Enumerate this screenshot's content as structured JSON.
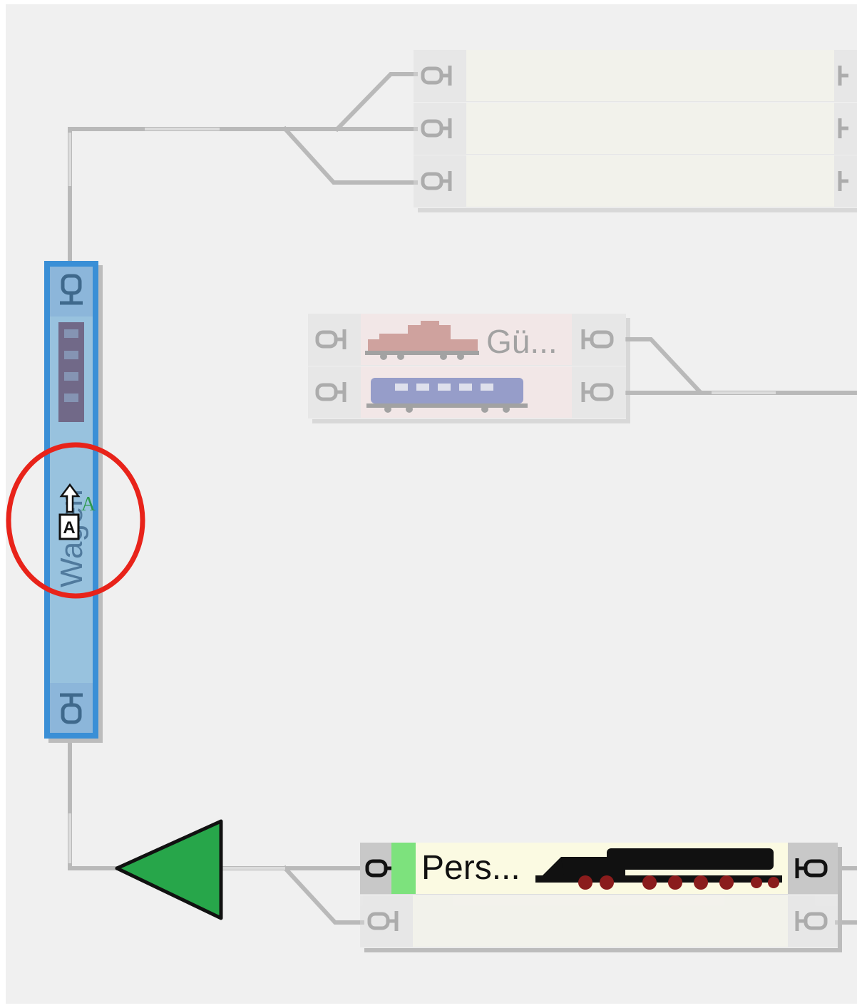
{
  "blocks": {
    "freight_block": {
      "train_label": "Gü..."
    },
    "passenger_block": {
      "train_label": "Pers..."
    },
    "wagon_block": {
      "train_label": "Wagen"
    }
  },
  "signal": {
    "aspect": "go",
    "color": "#27a64a"
  },
  "highlight": {
    "selection_color": "#3a8fd6",
    "marker_color": "#e8231a"
  },
  "icons": {
    "buffer": "buffer-stop-icon",
    "occupied": "occupied-indicator-icon",
    "auto": "auto-mode-icon"
  }
}
